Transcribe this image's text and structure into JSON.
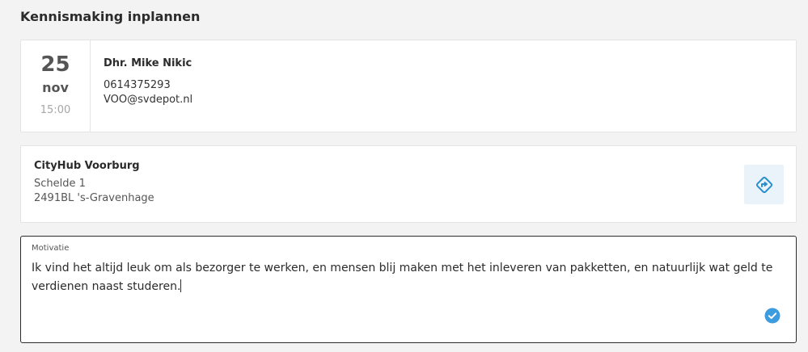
{
  "page": {
    "title": "Kennismaking inplannen"
  },
  "appointment": {
    "day": "25",
    "month": "nov",
    "time": "15:00",
    "contact": {
      "name": "Dhr. Mike Nikic",
      "phone": "0614375293",
      "email": "VOO@svdepot.nl"
    }
  },
  "location": {
    "name": "CityHub Voorburg",
    "street": "Schelde 1",
    "city": "2491BL 's-Gravenhage",
    "route_icon": "directions-icon"
  },
  "motivation": {
    "label": "Motivatie",
    "value": "Ik vind het altijd leuk om als bezorger te werken, en mensen blij maken met het inleveren van pakketten, en natuurlijk wat geld te verdienen naast studeren.",
    "valid_icon": "check-circle-icon"
  },
  "colors": {
    "accent": "#2a8fd0",
    "route_bg": "#eaf3fa",
    "valid": "#3d9be0"
  }
}
